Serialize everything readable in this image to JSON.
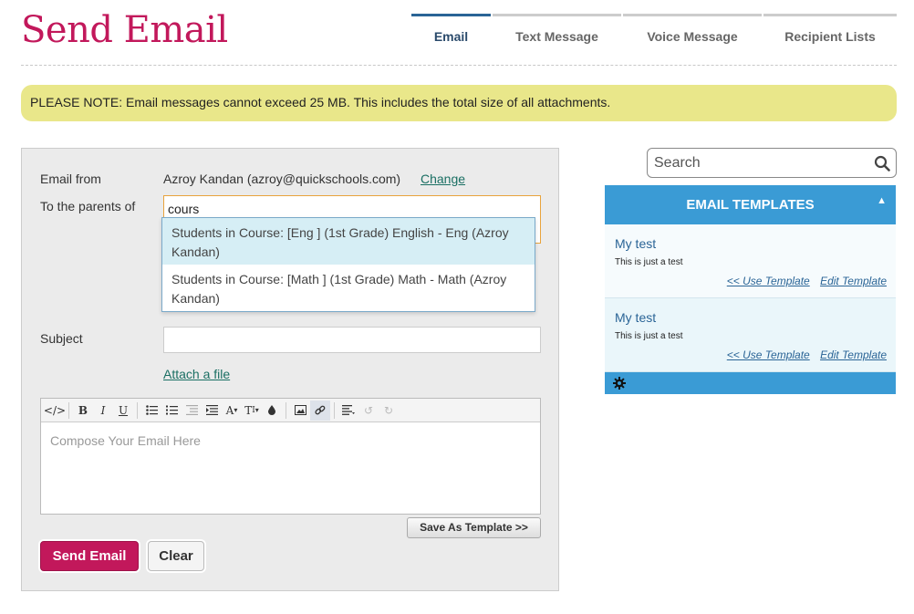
{
  "page": {
    "title": "Send Email"
  },
  "tabs": [
    {
      "label": "Email",
      "active": true
    },
    {
      "label": "Text Message"
    },
    {
      "label": "Voice Message"
    },
    {
      "label": "Recipient Lists"
    }
  ],
  "notice": "PLEASE NOTE: Email messages cannot exceed 25 MB. This includes the total size of all attachments.",
  "form": {
    "from_label": "Email from",
    "from_value": "Azroy Kandan (azroy@quickschools.com)",
    "change_link": "Change",
    "to_label": "To the parents of",
    "to_value": "cours",
    "suggestions": [
      "Students in Course: [Eng ] (1st Grade) English - Eng (Azroy Kandan)",
      "Students in Course: [Math ] (1st Grade) Math - Math (Azroy Kandan)"
    ],
    "subject_label": "Subject",
    "subject_value": "",
    "attach_link": "Attach a file",
    "editor_placeholder": "Compose Your Email Here",
    "save_template_label": "Save As Template >>",
    "send_label": "Send Email",
    "clear_label": "Clear"
  },
  "toolbar": {
    "icons": [
      "code-view-icon",
      "bold-icon",
      "italic-icon",
      "underline-icon",
      "bullet-list-icon",
      "numbered-list-icon",
      "outdent-icon",
      "indent-icon",
      "font-size-icon",
      "text-format-icon",
      "color-icon",
      "image-icon",
      "link-icon",
      "align-icon",
      "undo-icon",
      "redo-icon"
    ]
  },
  "search": {
    "placeholder": "Search"
  },
  "templates": {
    "header": "EMAIL TEMPLATES",
    "items": [
      {
        "name": "My test",
        "description": "This is just a test",
        "use_label": "<< Use Template",
        "edit_label": "Edit Template"
      },
      {
        "name": "My test",
        "description": "This is just a test",
        "use_label": "<< Use Template",
        "edit_label": "Edit Template"
      }
    ]
  },
  "colors": {
    "brand": "#c2185b",
    "accent": "#3a9bd5",
    "notice_bg": "#e9e78a",
    "link": "#1a6f63"
  }
}
